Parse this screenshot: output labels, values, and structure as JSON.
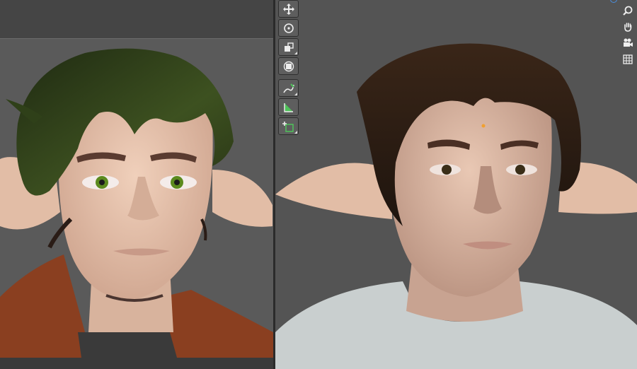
{
  "app": {
    "description_free": true
  },
  "viewports": {
    "left": {
      "name": "reference-render"
    },
    "right": {
      "name": "3d-viewport"
    }
  },
  "toolbar": {
    "tools": [
      {
        "icon": "move-icon",
        "active": false
      },
      {
        "icon": "rotate-icon",
        "active": false
      },
      {
        "icon": "scale-icon",
        "active": false
      },
      {
        "icon": "transform-icon",
        "active": false
      },
      {
        "icon": "annotate-icon",
        "active": false
      },
      {
        "icon": "measure-icon",
        "active": false
      },
      {
        "icon": "add-cube-icon",
        "active": false
      }
    ]
  },
  "navigation": {
    "buttons": [
      {
        "icon": "zoom-icon"
      },
      {
        "icon": "hand-pan-icon"
      },
      {
        "icon": "camera-icon"
      },
      {
        "icon": "grid-view-icon"
      }
    ]
  },
  "colors": {
    "left_bg": "#5a5a5a",
    "right_bg": "#545454",
    "skin": "#e7c3ac",
    "hair_left": "#2d3a18",
    "hair_right": "#2a1c14",
    "jacket": "#8a3f20",
    "shirt_right": "#c9cfcf"
  }
}
